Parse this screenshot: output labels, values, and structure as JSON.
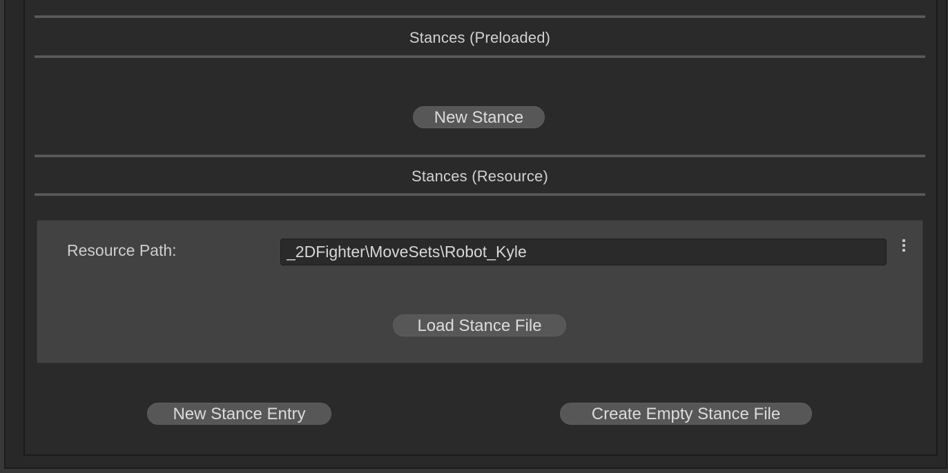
{
  "sections": {
    "preloaded": {
      "title": "Stances (Preloaded)",
      "new_button": "New Stance"
    },
    "resource": {
      "title": "Stances (Resource)",
      "path_label": "Resource Path:",
      "path_value": "_2DFighter\\MoveSets\\Robot_Kyle",
      "load_button": "Load Stance File"
    }
  },
  "footer": {
    "new_entry_button": "New Stance Entry",
    "create_empty_button": "Create Empty Stance File"
  },
  "icons": {
    "options": "kebab-menu-icon"
  },
  "colors": {
    "panel_bg": "#282828",
    "resource_box_bg": "#424242",
    "button_bg": "#575757",
    "text": "#d2d2d2"
  }
}
